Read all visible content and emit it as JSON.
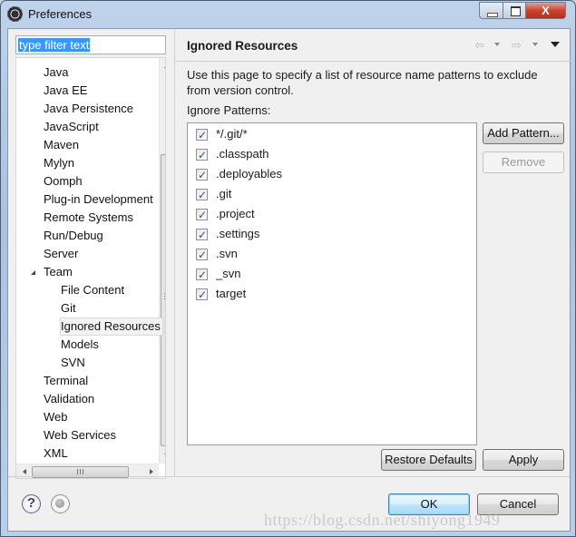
{
  "window": {
    "title": "Preferences",
    "controls": {
      "minimize": "minimize",
      "maximize": "maximize",
      "close_label": "X"
    }
  },
  "filter": {
    "value": "type filter text",
    "placeholder": "type filter text"
  },
  "tree": {
    "items": [
      {
        "label": "Java",
        "level": 0,
        "expander": "closed"
      },
      {
        "label": "Java EE",
        "level": 0,
        "expander": "closed"
      },
      {
        "label": "Java Persistence",
        "level": 0,
        "expander": "closed"
      },
      {
        "label": "JavaScript",
        "level": 0,
        "expander": "closed"
      },
      {
        "label": "Maven",
        "level": 0,
        "expander": "closed"
      },
      {
        "label": "Mylyn",
        "level": 0,
        "expander": "closed"
      },
      {
        "label": "Oomph",
        "level": 0,
        "expander": "closed"
      },
      {
        "label": "Plug-in Development",
        "level": 0,
        "expander": "closed"
      },
      {
        "label": "Remote Systems",
        "level": 0,
        "expander": "closed"
      },
      {
        "label": "Run/Debug",
        "level": 0,
        "expander": "closed"
      },
      {
        "label": "Server",
        "level": 0,
        "expander": "closed"
      },
      {
        "label": "Team",
        "level": 0,
        "expander": "open"
      },
      {
        "label": "File Content",
        "level": 1,
        "expander": "none"
      },
      {
        "label": "Git",
        "level": 1,
        "expander": "closed"
      },
      {
        "label": "Ignored Resources",
        "level": 1,
        "expander": "none",
        "selected": true
      },
      {
        "label": "Models",
        "level": 1,
        "expander": "none"
      },
      {
        "label": "SVN",
        "level": 1,
        "expander": "closed"
      },
      {
        "label": "Terminal",
        "level": 0,
        "expander": "closed"
      },
      {
        "label": "Validation",
        "level": 0,
        "expander": "none"
      },
      {
        "label": "Web",
        "level": 0,
        "expander": "closed"
      },
      {
        "label": "Web Services",
        "level": 0,
        "expander": "closed"
      },
      {
        "label": "XML",
        "level": 0,
        "expander": "closed"
      }
    ]
  },
  "page": {
    "title": "Ignored Resources",
    "nav": {
      "back": "back-arrow",
      "forward": "forward-arrow",
      "menu": "view-menu"
    },
    "description": "Use this page to specify a list of resource name patterns to exclude from version control.",
    "patterns_label": "Ignore Patterns:",
    "patterns": [
      {
        "text": "*/.git/*",
        "checked": true
      },
      {
        "text": ".classpath",
        "checked": true
      },
      {
        "text": ".deployables",
        "checked": true
      },
      {
        "text": ".git",
        "checked": true
      },
      {
        "text": ".project",
        "checked": true
      },
      {
        "text": ".settings",
        "checked": true
      },
      {
        "text": ".svn",
        "checked": true
      },
      {
        "text": "_svn",
        "checked": true
      },
      {
        "text": "target",
        "checked": true
      }
    ],
    "add_pattern": "Add Pattern...",
    "remove": "Remove",
    "restore_defaults": "Restore Defaults",
    "apply": "Apply"
  },
  "footer": {
    "help_icon": "?",
    "ok": "OK",
    "cancel": "Cancel"
  },
  "watermark": "https://blog.csdn.net/shiyong1949"
}
